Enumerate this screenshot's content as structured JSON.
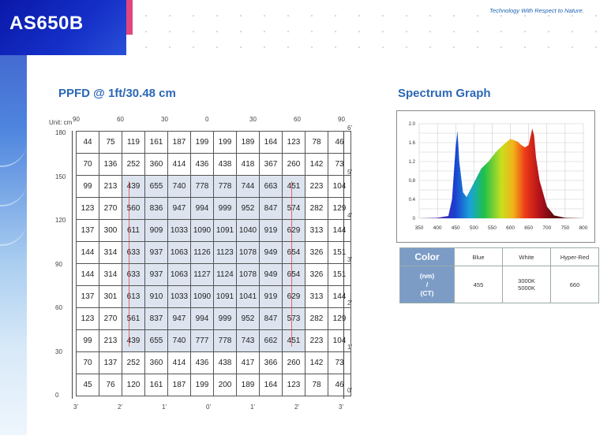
{
  "header": {
    "model": "AS650B",
    "tagline": "Technology With Respect to Nature."
  },
  "ppfd": {
    "title": "PPFD @ 1ft/30.48 cm",
    "unit_label": "Unit: cm",
    "top_axis": [
      "90",
      "60",
      "30",
      "0",
      "30",
      "60",
      "90"
    ],
    "left_axis": [
      "180",
      "150",
      "120",
      "90",
      "60",
      "30",
      "0"
    ],
    "right_axis": [
      "6'",
      "5'",
      "4'",
      "3'",
      "2'",
      "1'",
      "0'"
    ],
    "bottom_axis": [
      "3'",
      "2'",
      "1'",
      "0'",
      "1'",
      "2'",
      "3'"
    ],
    "rows": [
      [
        "44",
        "75",
        "119",
        "161",
        "187",
        "199",
        "199",
        "189",
        "164",
        "123",
        "78",
        "46"
      ],
      [
        "70",
        "136",
        "252",
        "360",
        "414",
        "436",
        "438",
        "418",
        "367",
        "260",
        "142",
        "73"
      ],
      [
        "99",
        "213",
        "439",
        "655",
        "740",
        "778",
        "778",
        "744",
        "663",
        "451",
        "223",
        "104"
      ],
      [
        "123",
        "270",
        "560",
        "836",
        "947",
        "994",
        "999",
        "952",
        "847",
        "574",
        "282",
        "129"
      ],
      [
        "137",
        "300",
        "611",
        "909",
        "1033",
        "1090",
        "1091",
        "1040",
        "919",
        "629",
        "313",
        "144"
      ],
      [
        "144",
        "314",
        "633",
        "937",
        "1063",
        "1126",
        "1123",
        "1078",
        "949",
        "654",
        "326",
        "151"
      ],
      [
        "144",
        "314",
        "633",
        "937",
        "1063",
        "1127",
        "1124",
        "1078",
        "949",
        "654",
        "326",
        "151"
      ],
      [
        "137",
        "301",
        "613",
        "910",
        "1033",
        "1090",
        "1091",
        "1041",
        "919",
        "629",
        "313",
        "144"
      ],
      [
        "123",
        "270",
        "561",
        "837",
        "947",
        "994",
        "999",
        "952",
        "847",
        "573",
        "282",
        "129"
      ],
      [
        "99",
        "213",
        "439",
        "655",
        "740",
        "777",
        "778",
        "743",
        "662",
        "451",
        "223",
        "104"
      ],
      [
        "70",
        "137",
        "252",
        "360",
        "414",
        "436",
        "438",
        "417",
        "366",
        "260",
        "142",
        "73"
      ],
      [
        "45",
        "76",
        "120",
        "161",
        "187",
        "199",
        "200",
        "189",
        "164",
        "123",
        "78",
        "46"
      ]
    ]
  },
  "spectrum": {
    "title": "Spectrum Graph",
    "chart_data": {
      "type": "area",
      "x": [
        350,
        400,
        430,
        440,
        450,
        455,
        460,
        470,
        480,
        500,
        520,
        540,
        560,
        580,
        600,
        620,
        630,
        640,
        650,
        660,
        665,
        670,
        680,
        700,
        720,
        750,
        800
      ],
      "values": [
        0,
        0.01,
        0.05,
        0.4,
        1.5,
        1.85,
        1.2,
        0.55,
        0.45,
        0.75,
        1.05,
        1.2,
        1.4,
        1.55,
        1.68,
        1.62,
        1.55,
        1.5,
        1.55,
        1.9,
        1.75,
        1.3,
        0.8,
        0.25,
        0.06,
        0.01,
        0
      ],
      "ylim": [
        0,
        2.0
      ],
      "xlim": [
        350,
        800
      ],
      "y_ticks": [
        "0",
        "0.4",
        "0.8",
        "1.2",
        "1.6",
        "2.0"
      ],
      "x_ticks": [
        "350",
        "400",
        "450",
        "500",
        "550",
        "600",
        "650",
        "700",
        "750",
        "800"
      ]
    },
    "table": {
      "header": "Color",
      "row_label": [
        "(nm)",
        "/",
        "(CT)"
      ],
      "columns": [
        {
          "name": "Blue",
          "value": "455"
        },
        {
          "name": "White",
          "value": "3000K\n5000K"
        },
        {
          "name": "Hyper-Red",
          "value": "660"
        }
      ]
    }
  }
}
